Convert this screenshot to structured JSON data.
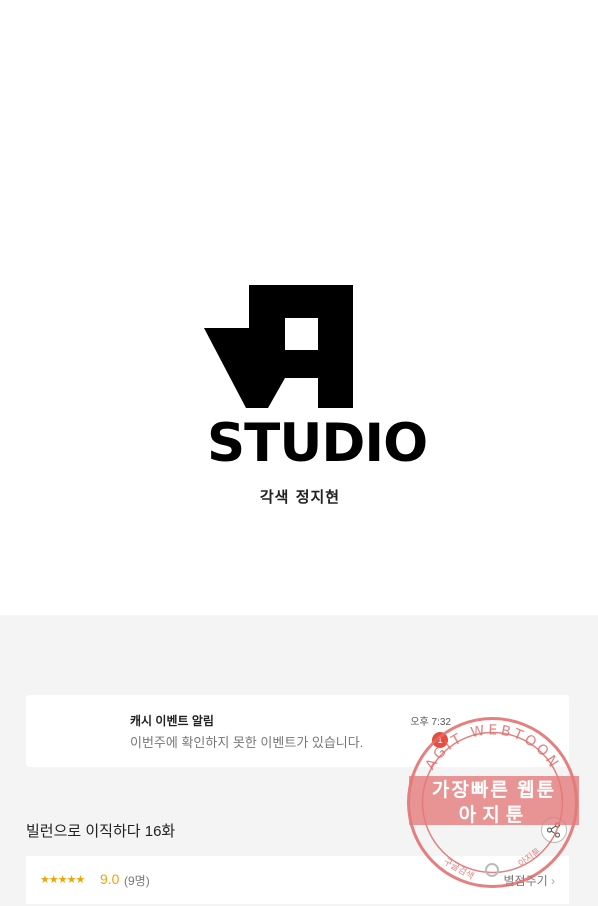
{
  "hero": {
    "logo_text": "STUDIO",
    "credit": "각색 정지현"
  },
  "notification": {
    "title": "캐시 이벤트 알림",
    "body": "이번주에 확인하지 못한 이벤트가 있습니다.",
    "time": "오후 7:32",
    "badge_count": "1"
  },
  "episode": {
    "title": "빌런으로 이직하다 16화"
  },
  "rating": {
    "stars": "★★★★★",
    "score": "9.0",
    "count": "(9명)",
    "rate_label": "별점주기"
  },
  "watermark": {
    "ring_text": "AGIT WEBTOON",
    "line1": "가장빠른 웹툰",
    "line2": "아지툰",
    "bottom_left": "구글검색",
    "bottom_right": "아지툰"
  },
  "colors": {
    "accent_star": "#f0a500",
    "badge": "#e74c3c",
    "watermark": "#e06a6a",
    "gray_bg": "#f4f4f5"
  }
}
